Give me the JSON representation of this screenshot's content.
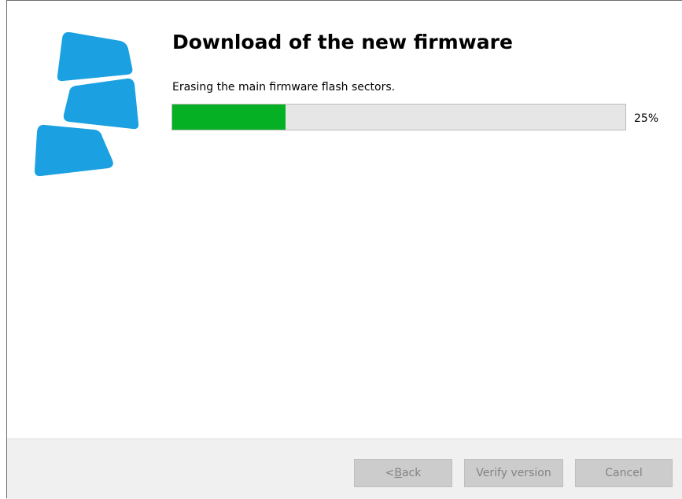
{
  "header": {
    "title": "Download of the new firmware",
    "status": "Erasing the main firmware flash sectors."
  },
  "progress": {
    "value": 25,
    "label": "25%"
  },
  "buttons": {
    "back": {
      "prefix": "< ",
      "mnemonic": "B",
      "rest": "ack",
      "enabled": false
    },
    "verify": {
      "label": "Verify version",
      "enabled": false
    },
    "cancel": {
      "label": "Cancel",
      "enabled": false
    }
  },
  "colors": {
    "logo": "#1ba1e2",
    "progress_fill": "#06b025",
    "progress_track": "#e6e6e6",
    "footer_bg": "#f0f0f0"
  },
  "icons": {
    "logo": "stacked-blocks-logo-icon"
  }
}
